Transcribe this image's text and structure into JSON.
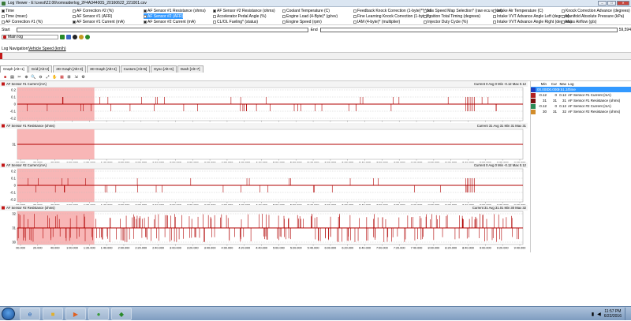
{
  "window": {
    "title": "Log Viewer - E:\\cvest\\22.06\\romraiderlog_2F4A34400S_20160622_221001.csv"
  },
  "params": [
    {
      "label": "Time",
      "checked": true,
      "selected": false
    },
    {
      "label": "Time (msec)",
      "checked": false,
      "selected": false
    },
    {
      "label": "AF Correction #1 (%)",
      "checked": false,
      "selected": false
    },
    {
      "label": "AF Correction #2 (%)",
      "checked": false,
      "selected": false
    },
    {
      "label": "AF Sensor #1 (AFR)",
      "checked": false,
      "selected": false
    },
    {
      "label": "AF Sensor #1 Current (mA)",
      "checked": true,
      "selected": false
    },
    {
      "label": "AF Sensor #1 Resistance (ohms)",
      "checked": true,
      "selected": false
    },
    {
      "label": "AF Sensor #2 (AFR)",
      "checked": false,
      "selected": true
    },
    {
      "label": "AF Sensor #2 Current (mA)",
      "checked": true,
      "selected": false
    },
    {
      "label": "AF Sensor #2 Resistance (ohms)",
      "checked": true,
      "selected": false
    },
    {
      "label": "Accelerator Pedal Angle (%)",
      "checked": false,
      "selected": false
    },
    {
      "label": "CL/OL Fueling* (status)",
      "checked": false,
      "selected": false
    },
    {
      "label": "Coolant Temperature (C)",
      "checked": false,
      "selected": false
    },
    {
      "label": "Engine Load (4-Byte)* (g/rev)",
      "checked": false,
      "selected": false
    },
    {
      "label": "Engine Speed (rpm)",
      "checked": false,
      "selected": false
    },
    {
      "label": "Feedback Knock Correction (1-byte)** (de...",
      "checked": false,
      "selected": false
    },
    {
      "label": "Fine Learning Knock Correction (1-byte)*...",
      "checked": false,
      "selected": false
    },
    {
      "label": "IAM (4-byte)* (multiplier)",
      "checked": false,
      "selected": false
    },
    {
      "label": "Idle Speed Map Selection* (raw ecu value)",
      "checked": false,
      "selected": false
    },
    {
      "label": "Ignition Total Timing (degrees)",
      "checked": false,
      "selected": false
    },
    {
      "label": "Injector Duty Cycle (%)",
      "checked": false,
      "selected": false
    },
    {
      "label": "Intake Air Temperature (C)",
      "checked": false,
      "selected": false
    },
    {
      "label": "Intake VVT Advance Angle Left (degrees)",
      "checked": false,
      "selected": false
    },
    {
      "label": "Intake VVT Advance Angle Right (degrees)",
      "checked": false,
      "selected": false
    },
    {
      "label": "Knock Correction Advance (degrees)",
      "checked": false,
      "selected": false
    },
    {
      "label": "Manifold Absolute Pressure (kPa)",
      "checked": false,
      "selected": false
    },
    {
      "label": "Mass Airflow (g/s)",
      "checked": false,
      "selected": false
    }
  ],
  "range": {
    "start_label": "Start",
    "end_label": "End",
    "end_value": "59,594"
  },
  "log_select": {
    "value": "Main log"
  },
  "nav": {
    "label": "Log Navigation:",
    "link": "Vehicle Speed (km/h)"
  },
  "tabs": [
    "Graph [Alt+1]",
    "Grid [Alt+2]",
    "2D Graph [Alt+3]",
    "3D Graph [Alt+4]",
    "Custom [Alt+5]",
    "Dyno [Alt+6]",
    "Dash [Alt+7]"
  ],
  "legend": {
    "headers": [
      "Min",
      "Cur",
      "Max",
      "Log"
    ],
    "rows": [
      {
        "min": "00.000",
        "cur": "00.000",
        "max": "9:51.34",
        "log": "Time",
        "color": "#1f3fbf",
        "selected": true
      },
      {
        "min": "-0.12",
        "cur": "0",
        "max": "0.12",
        "log": "AF Sensor #1 Current (mA)",
        "color": "#b22222",
        "selected": false
      },
      {
        "min": "31",
        "cur": "31",
        "max": "31",
        "log": "AF Sensor #1 Resistance (ohms)",
        "color": "#7a1010",
        "selected": false
      },
      {
        "min": "-0.12",
        "cur": "0",
        "max": "0.12",
        "log": "AF Sensor #2 Current (mA)",
        "color": "#2e8b57",
        "selected": false
      },
      {
        "min": "30",
        "cur": "31",
        "max": "32",
        "log": "AF Sensor #2 Resistance (ohms)",
        "color": "#d28c2a",
        "selected": false
      }
    ]
  },
  "graphs": [
    {
      "title": "AF Sensor #1 Current (mA)",
      "stats": "Current 0 Avg 0 Min -0.12 Max 0.12",
      "yticks": [
        "0.2",
        "0.1",
        "0",
        "-0.1",
        "-0.2"
      ]
    },
    {
      "title": "AF Sensor #1 Resistance (ohms)",
      "stats": "Current 31 Avg 31 Min 31 Max 31",
      "yticks": [
        "31"
      ]
    },
    {
      "title": "AF Sensor #2 Current (mA)",
      "stats": "Current 0 Avg 0 Min -0.12 Max 0.12",
      "yticks": [
        "0.2",
        "0.1",
        "0",
        "-0.1",
        "-0.2"
      ]
    },
    {
      "title": "AF Sensor #2 Resistance (ohms)",
      "stats": "Current 31 Avg 31.01 Min 30 Max 32",
      "yticks": [
        "32",
        "31",
        "30"
      ]
    }
  ],
  "xticks": [
    "00.000",
    "20.000",
    "40.000",
    "1:00.000",
    "1:20.000",
    "1:40.000",
    "2:00.000",
    "2:20.000",
    "2:40.000",
    "3:00.000",
    "3:20.000",
    "3:40.000",
    "4:00.000",
    "4:20.000",
    "4:40.000",
    "5:00.000",
    "5:20.000",
    "5:40.000",
    "6:00.000",
    "6:20.000",
    "6:40.000",
    "7:00.000",
    "7:20.000",
    "7:40.000",
    "8:00.000",
    "8:20.000",
    "8:40.000",
    "9:00.000",
    "9:20.000",
    "9:40.000"
  ],
  "taskbar": {
    "time": "11:57 PM",
    "date": "6/22/2016"
  }
}
